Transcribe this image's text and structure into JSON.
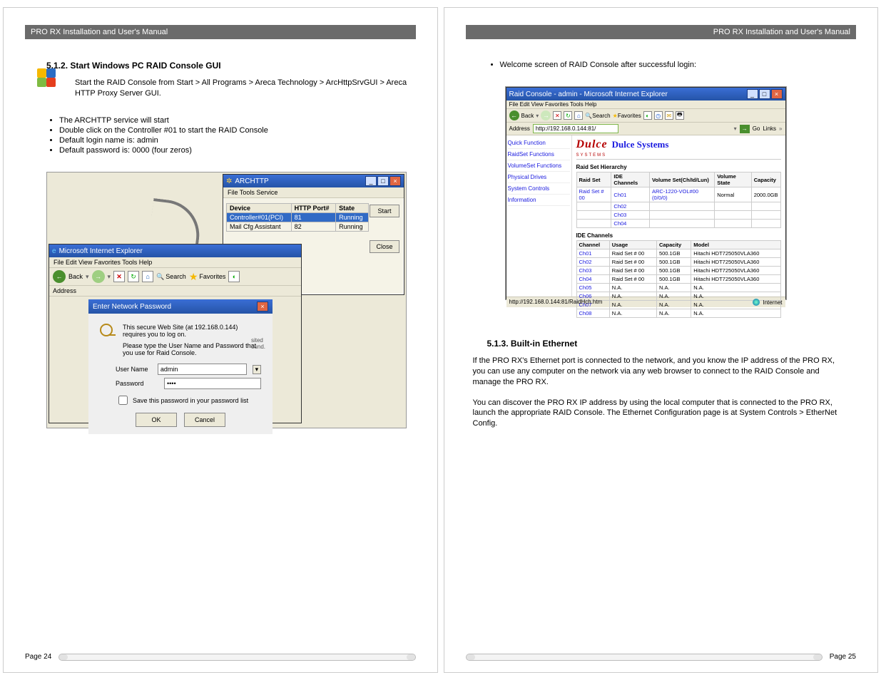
{
  "header_title": "PRO RX Installation and User's Manual",
  "left": {
    "section_num": "5.1.2. Start Windows PC RAID Console GUI",
    "intro": "Start the RAID Console from Start > All Programs > Areca Technology > ArcHttpSrvGUI > Areca HTTP Proxy Server GUI.",
    "bullets": [
      "The ARCHTTP service will start",
      "Double click on the Controller #01 to start the RAID Console",
      "Default login name is: admin",
      "Default password is: 0000 (four zeros)"
    ],
    "archttp": {
      "title": "ARCHTTP",
      "menu": "File   Tools   Service",
      "cols": [
        "Device",
        "HTTP Port#",
        "State"
      ],
      "rows": [
        [
          "Controller#01(PCI)",
          "81",
          "Running"
        ],
        [
          "Mail Cfg Assistant",
          "82",
          "Running"
        ]
      ],
      "start": "Start",
      "close": "Close"
    },
    "ie": {
      "title": "Microsoft Internet Explorer",
      "menu": "File    Edit    View    Favorites    Tools    Help",
      "back": "Back",
      "search": "Search",
      "favorites": "Favorites",
      "address": "Address",
      "bg_label": "sited\nound."
    },
    "login": {
      "bar": "Enter Network Password",
      "line1": "This secure Web Site (at 192.168.0.144) requires you to log on.",
      "line2": "Please type the User Name and Password that you use for Raid Console.",
      "username_lbl": "User Name",
      "username_val": "admin",
      "password_lbl": "Password",
      "password_val": "****",
      "save_chk": "Save this password in your password list",
      "ok": "OK",
      "cancel": "Cancel"
    },
    "page_num": "Page 24"
  },
  "right": {
    "welcome_bullet": "Welcome screen of RAID Console after successful login:",
    "rc": {
      "title": "Raid Console - admin - Microsoft Internet Explorer",
      "menu": "File   Edit   View   Favorites   Tools   Help",
      "back": "Back",
      "search": "Search",
      "favorites": "Favorites",
      "addr_lbl": "Address",
      "addr_val": "http://192.168.0.144:81/",
      "go": "Go",
      "links": "Links",
      "side": [
        "Quick Function",
        "RaidSet Functions",
        "VolumeSet Functions",
        "Physical Drives",
        "System Controls",
        "Information"
      ],
      "logo1": "Dulce",
      "logo2": "Dulce Systems",
      "logosub": "SYSTEMS",
      "hier_title": "Raid Set Hierarchy",
      "hier_cols": [
        "Raid Set",
        "IDE Channels",
        "Volume Set(Ch/Id/Lun)",
        "Volume State",
        "Capacity"
      ],
      "hier_rows": [
        [
          "Raid Set # 00",
          "Ch01",
          "ARC-1220-VOL#00 (0/0/0)",
          "Normal",
          "2000.0GB"
        ],
        [
          "",
          "Ch02",
          "",
          "",
          ""
        ],
        [
          "",
          "Ch03",
          "",
          "",
          ""
        ],
        [
          "",
          "Ch04",
          "",
          "",
          ""
        ]
      ],
      "ide_title": "IDE Channels",
      "ide_cols": [
        "Channel",
        "Usage",
        "Capacity",
        "Model"
      ],
      "ide_rows": [
        [
          "Ch01",
          "Raid Set # 00",
          "500.1GB",
          "Hitachi HDT725050VLA360"
        ],
        [
          "Ch02",
          "Raid Set # 00",
          "500.1GB",
          "Hitachi HDT725050VLA360"
        ],
        [
          "Ch03",
          "Raid Set # 00",
          "500.1GB",
          "Hitachi HDT725050VLA360"
        ],
        [
          "Ch04",
          "Raid Set # 00",
          "500.1GB",
          "Hitachi HDT725050VLA360"
        ],
        [
          "Ch05",
          "N.A.",
          "N.A.",
          "N.A."
        ],
        [
          "Ch06",
          "N.A.",
          "N.A.",
          "N.A."
        ],
        [
          "Ch07",
          "N.A.",
          "N.A.",
          "N.A."
        ],
        [
          "Ch08",
          "N.A.",
          "N.A.",
          "N.A."
        ]
      ],
      "status_url": "http://192.168.0.144:81/RaidHch.htm",
      "status_inet": "Internet"
    },
    "section_num": "5.1.3. Built-in Ethernet",
    "para1": "If the PRO RX's Ethernet port is connected to the network, and you know the IP address of the PRO RX, you can use any computer on the network via any web browser to connect to the RAID Console and manage the PRO RX.",
    "para2": "You can discover the PRO RX IP address by using the local computer that is connected to the PRO RX, launch the appropriate RAID Console.  The Ethernet Configuration page is at System Controls > EtherNet Config.",
    "page_num": "Page 25"
  }
}
